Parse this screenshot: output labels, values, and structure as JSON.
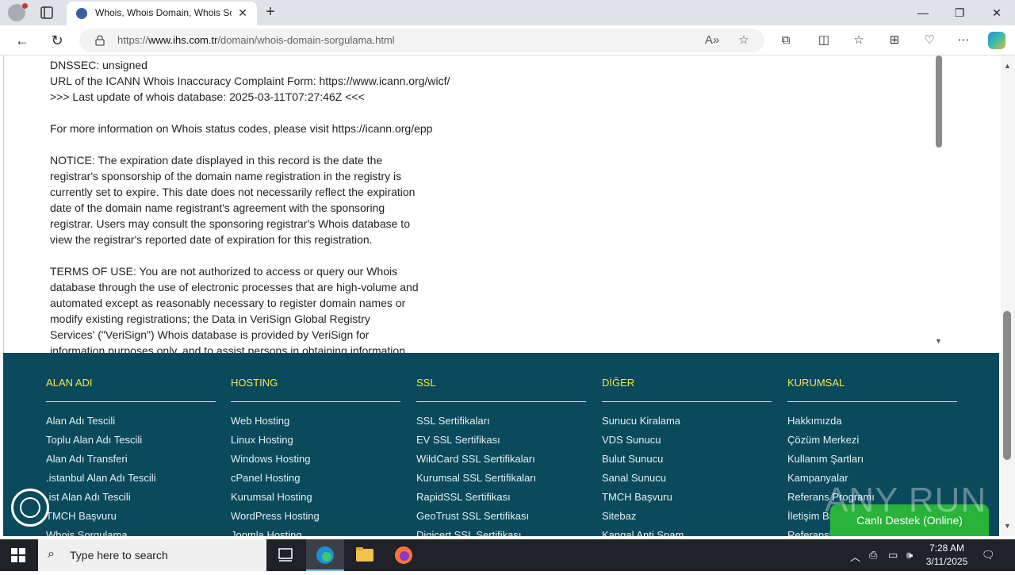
{
  "browser": {
    "tab_title": "Whois, Whois Domain, Whois Sorgulama",
    "url_prefix": "https://",
    "url_host": "www.ihs.com.tr",
    "url_path": "/domain/whois-domain-sorgulama.html"
  },
  "whois": {
    "lines": [
      "DNSSEC: unsigned",
      "URL of the ICANN Whois Inaccuracy Complaint Form: https://www.icann.org/wicf/",
      ">>> Last update of whois database: 2025-03-11T07:27:46Z <<<",
      "",
      "For more information on Whois status codes, please visit https://icann.org/epp",
      "",
      "NOTICE: The expiration date displayed in this record is the date the",
      "registrar's sponsorship of the domain name registration in the registry is",
      "currently set to expire. This date does not necessarily reflect the expiration",
      "date of the domain name registrant's agreement with the sponsoring",
      "registrar. Users may consult the sponsoring registrar's Whois database to",
      "view the registrar's reported date of expiration for this registration.",
      "",
      "TERMS OF USE: You are not authorized to access or query our Whois",
      "database through the use of electronic processes that are high-volume and",
      "automated except as reasonably necessary to register domain names or",
      "modify existing registrations; the Data in VeriSign Global Registry",
      "Services' (\"VeriSign\") Whois database is provided by VeriSign for",
      "information purposes only, and to assist persons in obtaining information"
    ]
  },
  "footer": {
    "columns": [
      {
        "heading": "ALAN ADI",
        "links": [
          "Alan Adı Tescili",
          "Toplu Alan Adı Tescili",
          "Alan Adı Transferi",
          ".istanbul Alan Adı Tescili",
          ".ist Alan Adı Tescili",
          "TMCH Başvuru",
          "Whois Sorgulama"
        ]
      },
      {
        "heading": "HOSTING",
        "links": [
          "Web Hosting",
          "Linux Hosting",
          "Windows Hosting",
          "cPanel Hosting",
          "Kurumsal Hosting",
          "WordPress Hosting",
          "Joomla Hosting"
        ]
      },
      {
        "heading": "SSL",
        "links": [
          "SSL Sertifikaları",
          "EV SSL Sertifikası",
          "WildCard SSL Sertifikaları",
          "Kurumsal SSL Sertifikaları",
          "RapidSSL Sertifikası",
          "GeoTrust SSL Sertifikası",
          "Digicert SSL Sertifikası"
        ]
      },
      {
        "heading": "DİĞER",
        "links": [
          "Sunucu Kiralama",
          "VDS Sunucu",
          "Bulut Sunucu",
          "Sanal Sunucu",
          "TMCH Başvuru",
          "Sitebaz",
          "Kangal Anti Spam"
        ]
      },
      {
        "heading": "KURUMSAL",
        "links": [
          "Hakkımızda",
          "Çözüm Merkezi",
          "Kullanım Şartları",
          "Kampanyalar",
          "Referans Programı",
          "İletişim Bilgileri",
          "Referanslar"
        ]
      }
    ],
    "live_support": "Canlı Destek (Online)",
    "watermark": "ANY RUN"
  },
  "taskbar": {
    "search_placeholder": "Type here to search",
    "time": "7:28 AM",
    "date": "3/11/2025"
  },
  "colors": {
    "footer_bg": "#0b4a5c",
    "footer_heading": "#f2e35a",
    "live_support": "#2ab33b"
  }
}
